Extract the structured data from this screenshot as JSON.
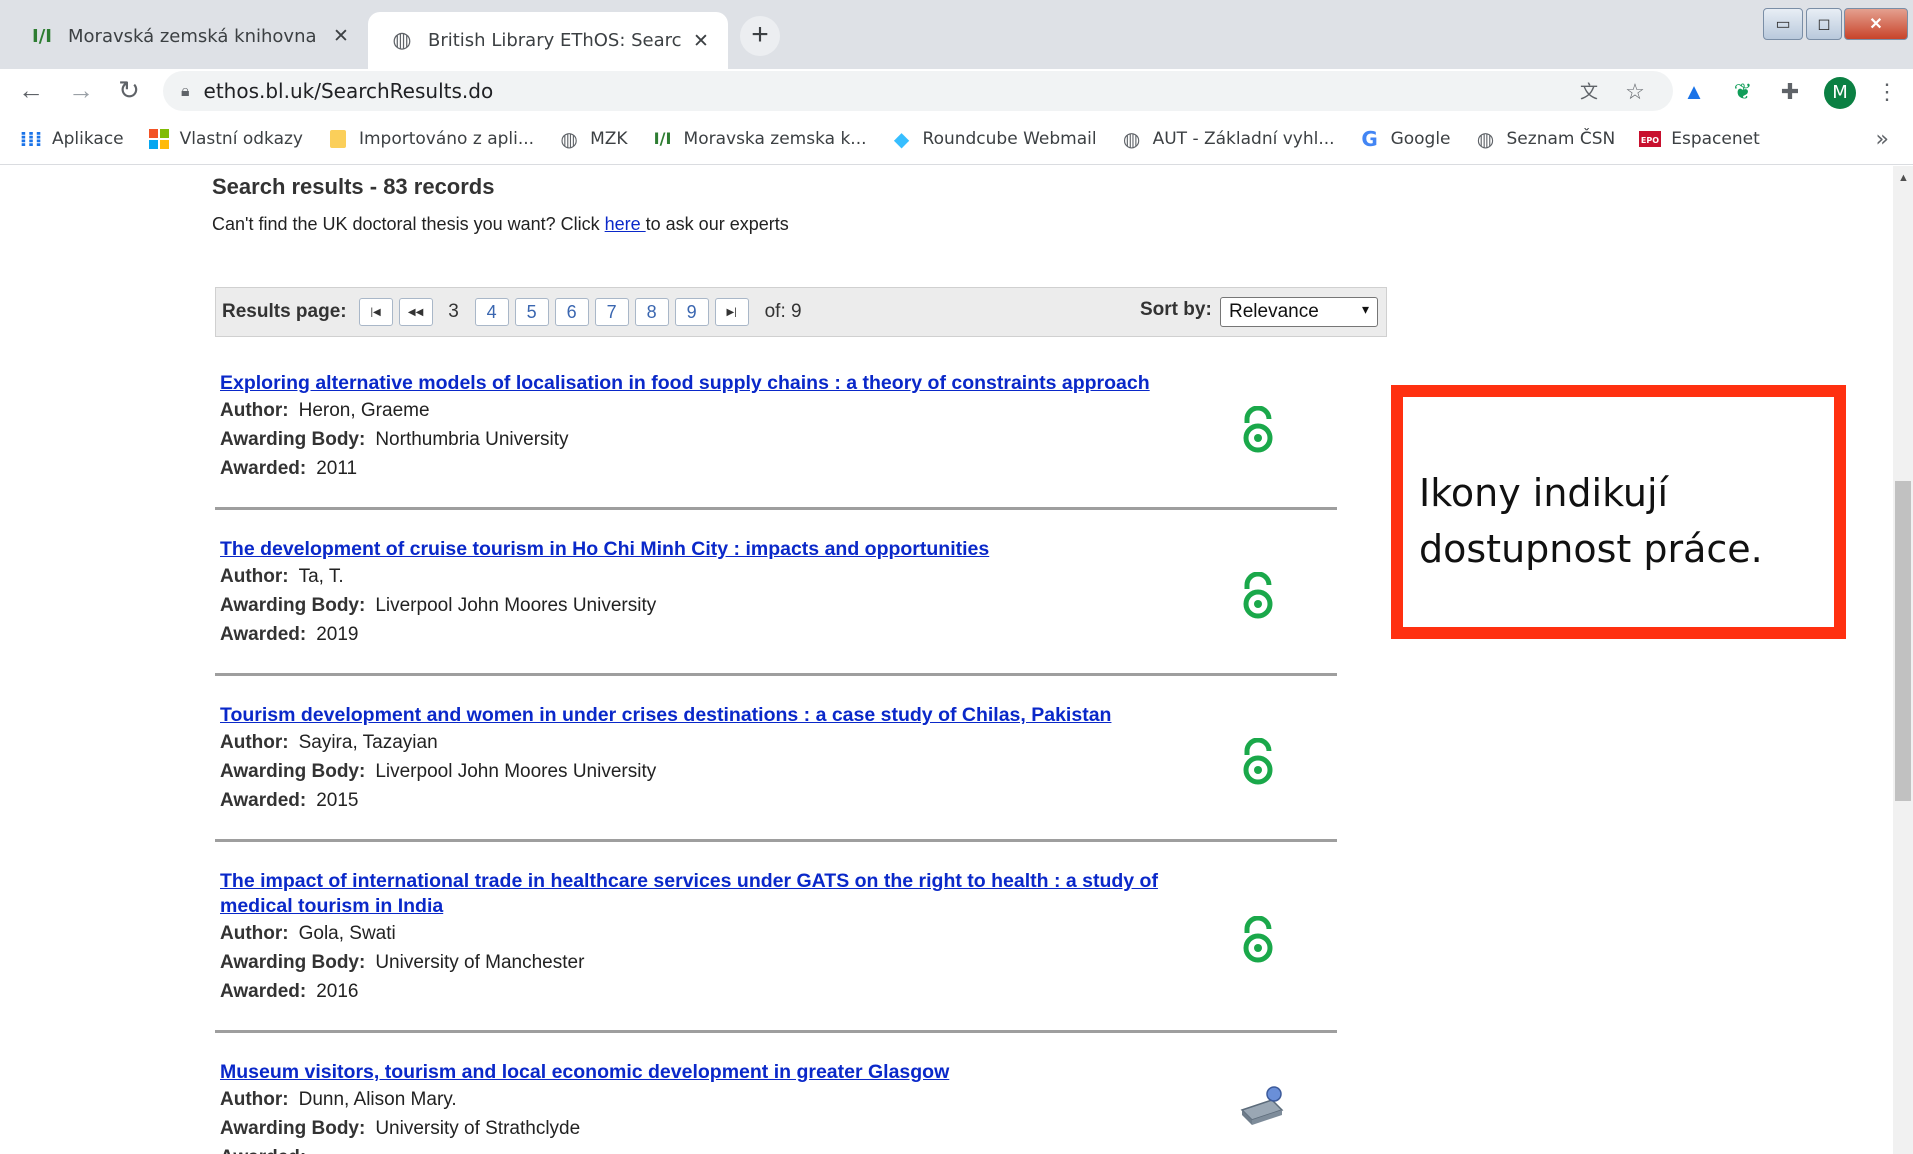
{
  "browser": {
    "tabs": [
      {
        "title": "Moravská zemská knihovna v Brn",
        "favicon": "mzk-logo-icon",
        "active": false
      },
      {
        "title": "British Library EThOS: Search Res",
        "favicon": "globe-icon",
        "active": true
      }
    ],
    "url": "ethos.bl.uk/SearchResults.do",
    "profile_initial": "M",
    "bookmarks": [
      {
        "label": "Aplikace",
        "icon": "apps-grid-icon"
      },
      {
        "label": "Vlastní odkazy",
        "icon": "windows-logo-icon"
      },
      {
        "label": "Importováno z apli...",
        "icon": "folder-icon"
      },
      {
        "label": "MZK",
        "icon": "globe-icon"
      },
      {
        "label": "Moravska zemska k...",
        "icon": "mzk-logo-icon"
      },
      {
        "label": "Roundcube Webmail",
        "icon": "roundcube-icon"
      },
      {
        "label": "AUT - Základní vyhl...",
        "icon": "globe-icon"
      },
      {
        "label": "Google",
        "icon": "google-icon"
      },
      {
        "label": "Seznam ČSN",
        "icon": "globe-icon"
      },
      {
        "label": "Espacenet",
        "icon": "epo-icon"
      }
    ]
  },
  "search": {
    "heading": "Search results - 83 records",
    "cant_find_prefix": "Can't find the UK doctoral thesis you want? Click ",
    "cant_find_link": "here ",
    "cant_find_suffix": "to ask our experts",
    "pager_label": "Results page:",
    "current_page": "3",
    "pages": [
      "4",
      "5",
      "6",
      "7",
      "8",
      "9"
    ],
    "of_label": "of: 9",
    "sort_label": "Sort by:",
    "sort_value": "Relevance"
  },
  "labels": {
    "author": "Author:",
    "awarding_body": "Awarding Body:",
    "awarded": "Awarded:"
  },
  "results": [
    {
      "title": "Exploring alternative models of localisation in food supply chains : a theory of constraints approach",
      "author": "Heron, Graeme",
      "awarding_body": "Northumbria University",
      "awarded": "2011",
      "availability_icon": "open-access-icon"
    },
    {
      "title": "The development of cruise tourism in Ho Chi Minh City : impacts and opportunities",
      "author": "Ta, T.",
      "awarding_body": "Liverpool John Moores University",
      "awarded": "2019",
      "availability_icon": "open-access-icon"
    },
    {
      "title": "Tourism development and women in under crises destinations : a case study of Chilas, Pakistan",
      "author": "Sayira, Tazayian",
      "awarding_body": "Liverpool John Moores University",
      "awarded": "2015",
      "availability_icon": "open-access-icon"
    },
    {
      "title": "The impact of international trade in healthcare services under GATS on the right to health : a study of medical tourism in India",
      "author": "Gola, Swati",
      "awarding_body": "University of Manchester",
      "awarded": "2016",
      "availability_icon": "open-access-icon"
    },
    {
      "title": "Museum visitors, tourism and local economic development in greater Glasgow",
      "author": "Dunn, Alison Mary.",
      "awarding_body": "University of Strathclyde",
      "awarded": "",
      "availability_icon": "scan-request-icon"
    }
  ],
  "callout": {
    "text": "Ikony indikují dostupnost práce."
  },
  "colors": {
    "link": "#0a28c9",
    "open_access": "#1aa84a",
    "callout_border": "#ff3010"
  }
}
